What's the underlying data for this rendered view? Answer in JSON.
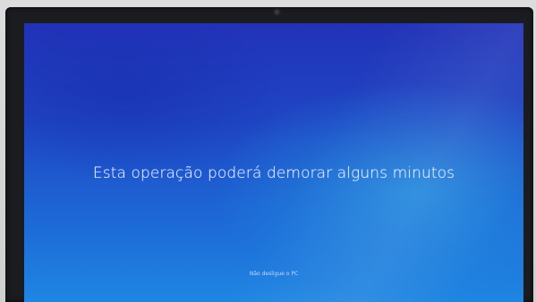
{
  "update_screen": {
    "message": "Esta operação poderá demorar alguns minutos",
    "hint": "Não desligue o PC"
  },
  "colors": {
    "screen_top": "#2232b8",
    "screen_bottom": "#1f86e2",
    "text": "#e9f0ff",
    "bezel": "#1b1c20"
  },
  "icons": [
    "webcam-icon"
  ]
}
